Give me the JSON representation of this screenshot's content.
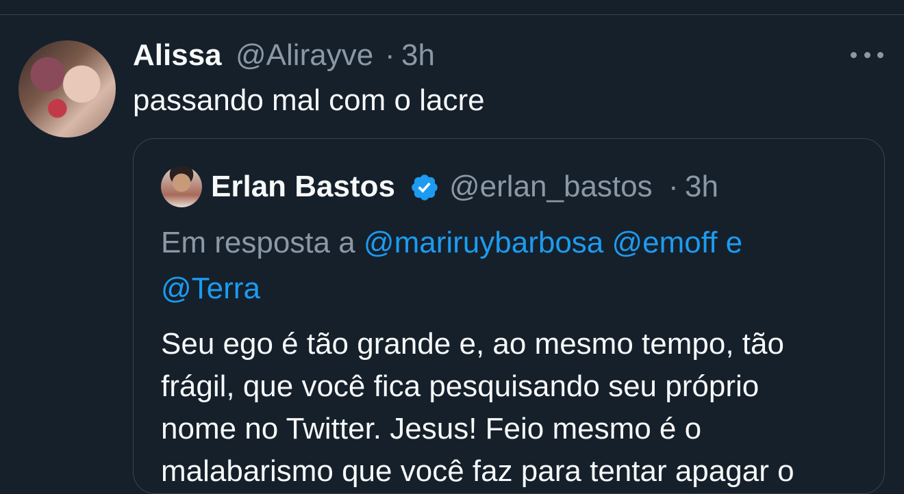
{
  "tweet": {
    "display_name": "Alissa",
    "handle": "@Alirayve",
    "separator": "·",
    "time": "3h",
    "text": "passando mal com o lacre"
  },
  "quoted_tweet": {
    "display_name": "Erlan Bastos",
    "verified": true,
    "handle": "@erlan_bastos",
    "separator": "·",
    "time": "3h",
    "reply_prefix": "Em resposta a",
    "mentions": [
      "@mariruybarbosa",
      "@emoff",
      "@Terra"
    ],
    "mention_joiner": "e",
    "body_lines": [
      "Seu ego é tão grande e, ao mesmo tempo, tão",
      "frágil, que você fica pesquisando seu próprio",
      "nome no Twitter. Jesus! Feio mesmo é o",
      "malabarismo que você faz para tentar apagar o"
    ]
  },
  "icons": {
    "more": "more-horizontal-icon",
    "verified": "verified-badge-icon"
  },
  "colors": {
    "background": "#15202b",
    "text_primary": "#f7f9f9",
    "text_muted": "#8b98a5",
    "accent": "#1d9bf0",
    "border": "#38444d"
  }
}
